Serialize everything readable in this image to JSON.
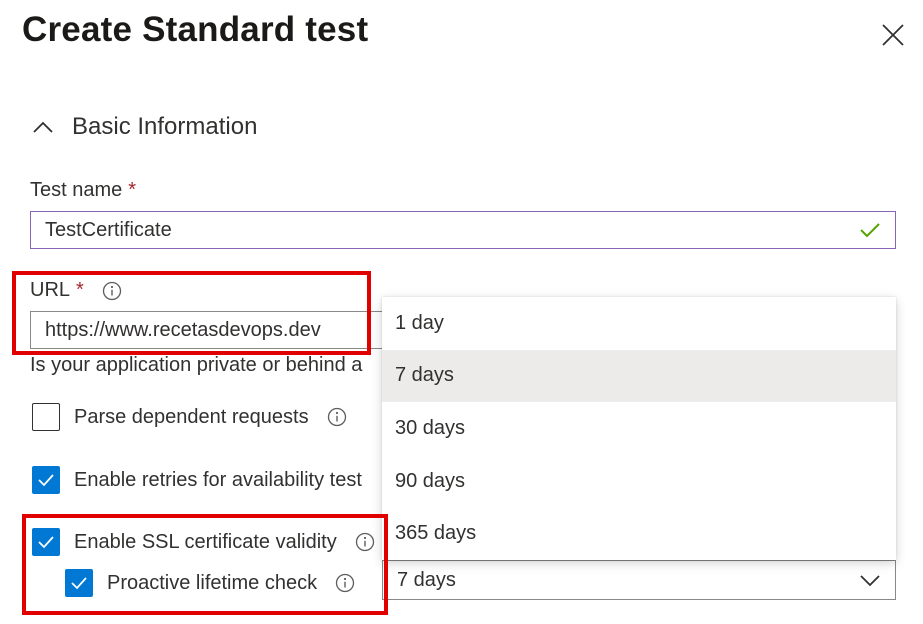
{
  "panel": {
    "title": "Create Standard test",
    "close_icon": "close-icon"
  },
  "section": {
    "label": "Basic Information",
    "icon": "chevron-up-icon"
  },
  "test_name": {
    "label": "Test name",
    "required_mark": "*",
    "value": "TestCertificate",
    "valid_icon": "checkmark-icon",
    "valid_color": "#57a300"
  },
  "url": {
    "label": "URL",
    "required_mark": "*",
    "info_icon": "info-icon",
    "value": "https://www.recetasdevops.dev",
    "helper_text": "Is your application private or behind a"
  },
  "checkboxes": {
    "parse_dependent": {
      "label": "Parse dependent requests",
      "checked": false
    },
    "enable_retries": {
      "label": "Enable retries for availability test",
      "checked": true
    },
    "ssl_validity": {
      "label": "Enable SSL certificate validity",
      "checked": true
    },
    "proactive_lifetime": {
      "label": "Proactive lifetime check",
      "checked": true
    }
  },
  "lifetime_dropdown": {
    "selected": "7 days",
    "options": [
      "1 day",
      "7 days",
      "30 days",
      "90 days",
      "365 days"
    ],
    "highlighted_option": "7 days"
  },
  "colors": {
    "accent": "#0078d4",
    "required": "#a4262c",
    "focus_border": "#8764b8",
    "annotation_red": "#e00000",
    "hover_bg": "#edebe9"
  }
}
